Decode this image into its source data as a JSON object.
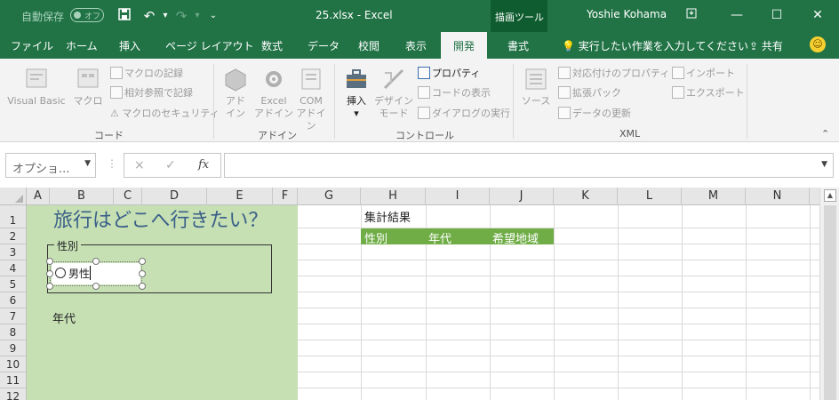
{
  "titlebar": {
    "autosave_label": "自動保存",
    "autosave_state": "オフ",
    "document_title": "25.xlsx - Excel",
    "contextual_group": "描画ツール",
    "user_name": "Yoshie Kohama"
  },
  "tabs": [
    {
      "label": "ファイル"
    },
    {
      "label": "ホーム"
    },
    {
      "label": "挿入"
    },
    {
      "label": "ページ レイアウト"
    },
    {
      "label": "数式"
    },
    {
      "label": "データ"
    },
    {
      "label": "校閲"
    },
    {
      "label": "表示"
    },
    {
      "label": "開発"
    },
    {
      "label": "書式"
    }
  ],
  "active_tab": "開発",
  "tell_me": "実行したい作業を入力してください",
  "share": "共有",
  "ribbon": {
    "code": {
      "label": "コード",
      "visual_basic": "Visual Basic",
      "macro": "マクロ",
      "record_macro": "マクロの記録",
      "relative_ref": "相対参照で記録",
      "macro_security": "マクロのセキュリティ"
    },
    "addins": {
      "label": "アドイン",
      "addin": "アド\nイン",
      "excel_addin": "Excel\nアドイン",
      "com_addin": "COM\nアドイン"
    },
    "controls": {
      "label": "コントロール",
      "insert": "挿入",
      "design_mode": "デザイン\nモード",
      "properties": "プロパティ",
      "view_code": "コードの表示",
      "run_dialog": "ダイアログの実行"
    },
    "xml": {
      "label": "XML",
      "source": "ソース",
      "map_properties": "対応付けのプロパティ",
      "expansion_pack": "拡張パック",
      "refresh_data": "データの更新",
      "import": "インポート",
      "export": "エクスポート"
    }
  },
  "formula_bar": {
    "name_box": "オプショ...",
    "cancel": "×",
    "enter": "✓",
    "fx": "fx",
    "value": ""
  },
  "columns": [
    "A",
    "B",
    "C",
    "D",
    "E",
    "F",
    "G",
    "H",
    "I",
    "J",
    "K",
    "L",
    "M",
    "N"
  ],
  "rows": [
    "1",
    "2",
    "3",
    "4",
    "5",
    "6",
    "7",
    "8",
    "9",
    "10",
    "11",
    "12"
  ],
  "sheet": {
    "title": "旅行はどこへ行きたい？",
    "gender_group_label": "性別",
    "radio_option": "男性",
    "age_label": "年代",
    "tally_title": "集計結果",
    "tally_headers": [
      "性別",
      "年代",
      "希望地域"
    ]
  },
  "colors": {
    "excel_green": "#217346",
    "form_background": "#c6e0b4",
    "header_green": "#70ad47",
    "title_blue": "#3a5f88"
  }
}
